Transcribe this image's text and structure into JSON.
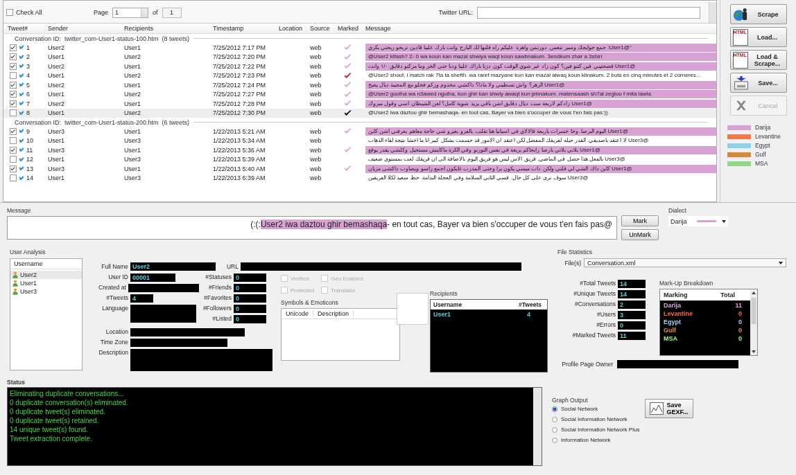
{
  "toolbar": {
    "check_all": {
      "label": "Check All",
      "checked": false
    },
    "page_label": "Page",
    "page_value": "1",
    "of_label": "of",
    "page_count": "1",
    "url_label": "Twitter URL:"
  },
  "table": {
    "columns": [
      "Tweet#",
      "Sender",
      "Recipients",
      "Timestamp",
      "Location",
      "Source",
      "Marked",
      "Message"
    ],
    "groups": [
      {
        "title": "Conversation ID:  twitter_com-User1-status-100.htm  (8 tweets)",
        "rows": [
          {
            "checked": true,
            "num": "1",
            "sender": "User2",
            "recipient": "User1",
            "time": "7/25/2012 7:17 PM",
            "source": "web",
            "kind": "dialect",
            "highlighted": true,
            "selected": false,
            "rtl": true,
            "message": "\"@User1: جمع حوايجك وسير تنعس. دورتمن واهرة عليكم راه قلتها لك البارح وانت بارك علينا قادين تربحو ربحتي بكري"
          },
          {
            "checked": true,
            "num": "2",
            "sender": "User1",
            "recipient": "User2",
            "time": "7/25/2012 7:20 PM",
            "source": "web",
            "kind": "dialect",
            "highlighted": true,
            "selected": false,
            "rtl": false,
            "message": "@User2 kifash?  2- 0 wa koun kan mazal shwiya waqt koun sawbnakum. 3endkum zhar a 3shiri"
          },
          {
            "checked": true,
            "num": "3",
            "sender": "User2",
            "recipient": "User1",
            "time": "7/25/2012 7:22 PM",
            "source": "web",
            "kind": "dialect",
            "highlighted": true,
            "selected": false,
            "rtl": true,
            "message": "@User1 فضحتيني فين كنتو فين؟ كون زاد غير شوي الوقت كون دزنا باراك علينا ودبا حتى الخر وما مركتو دقايق ١/٠ وانت"
          },
          {
            "checked": false,
            "num": "4",
            "sender": "User1",
            "recipient": "User2",
            "time": "7/25/2012 7:23 PM",
            "source": "web",
            "kind": "new",
            "highlighted": false,
            "selected": false,
            "rtl": false,
            "message": "@User2 shouf, l match rak 7ta ta shefth.  wa raref mazyane kun kan mazal alwaq koun klinakum. 2 buts en cinq minutes et 2 corneres..."
          },
          {
            "checked": true,
            "num": "5",
            "sender": "User2",
            "recipient": "User1",
            "time": "7/25/2012 7:24 PM",
            "source": "web",
            "kind": "dialect",
            "highlighted": true,
            "selected": false,
            "rtl": true,
            "message": "@User1 الزهر؟ واش تسطيني ولا ماذا؟ داكشي مخدوم وزكم فخلو مع المجيبة ديال يصح"
          },
          {
            "checked": true,
            "num": "6",
            "sender": "User1",
            "recipient": "User2",
            "time": "7/25/2012 7:27 PM",
            "source": "web",
            "kind": "dialect",
            "highlighted": true,
            "selected": false,
            "rtl": false,
            "message": "@User2 guolha wa n3awed ngulha, kun ghir kan shwiy awaqt kun jebnakum. matensaash sh7al zeglou f mita lawla"
          },
          {
            "checked": true,
            "num": "7",
            "sender": "User2",
            "recipient": "User1",
            "time": "7/25/2012 7:28 PM",
            "source": "web",
            "kind": "dialect",
            "highlighted": true,
            "selected": false,
            "rtl": true,
            "message": "@User1 زادكم لاربعة ست ديال دقايق اشن باقي يزيد شوية كامل؟ لعن الشيطان اسي وقول مبروك"
          },
          {
            "checked": false,
            "num": "8",
            "sender": "User1",
            "recipient": "User2",
            "time": "7/25/2012 7:30 PM",
            "source": "web",
            "kind": "current",
            "highlighted": false,
            "selected": true,
            "rtl": false,
            "message": "@User2 iwa daztou ghir bemashaqa- en tout cas, Bayer va bien s'occuper de vous t'en fais pas:))"
          }
        ]
      },
      {
        "title": "Conversation ID:  twitter_com-User1-status-200.htm  (6 tweets)",
        "rows": [
          {
            "checked": true,
            "num": "9",
            "sender": "User3",
            "recipient": "User1",
            "time": "1/22/2013 5:21 AM",
            "source": "web",
            "kind": "dialect",
            "highlighted": true,
            "selected": false,
            "rtl": true,
            "message": "@User1 اليوم البرصا. وخا خسرات باربعة فالالاي في اسبانيا هنا تقلب. بالفرو بغيرو شي حاجة معاهم يعرفني اشن كاين"
          },
          {
            "checked": false,
            "num": "10",
            "sender": "User1",
            "recipient": "User3",
            "time": "1/22/2013 5:34 AM",
            "source": "web",
            "kind": "none",
            "highlighted": false,
            "selected": false,
            "rtl": true,
            "message": "@User3 لا اعتقد باصديقي. القدر حيله لفريقك المفضل لكن اعتقد ان الامور قد حسمت بشكل كبير انا ما اخشا نتيجة لقاء الذهاب"
          },
          {
            "checked": true,
            "num": "11",
            "sender": "User3",
            "recipient": "User1",
            "time": "1/22/2013 5:36 AM",
            "source": "web",
            "kind": "dialect",
            "highlighted": true,
            "selected": false,
            "rtl": true,
            "message": "@User1 بلاتي بلاتي بارصا رابحاكم بربعة في نفس التورنو وفي الكرة ماكاينش مستحيل وكلشي يقدر يوقع"
          },
          {
            "checked": false,
            "num": "12",
            "sender": "User1",
            "recipient": "User3",
            "time": "1/22/2013 5:39 AM",
            "source": "web",
            "kind": "none",
            "highlighted": false,
            "selected": false,
            "rtl": true,
            "message": "@User3 بالفعل هذا حصل في الماضي. فريق الاس ليس هو فريق اليوم بالاضافة الى ان فريقك لعب بمستوى ضعيف"
          },
          {
            "checked": true,
            "num": "13",
            "sender": "User3",
            "recipient": "User1",
            "time": "1/22/2013 5:40 AM",
            "source": "web",
            "kind": "dialect",
            "highlighted": true,
            "selected": false,
            "rtl": true,
            "message": "@User1 كاين داك الشي لي قلتي ولكن داب ميسي يكون برا وحتى المدرب غايكون اجمع راسو ويصاوب داكشي مزيان"
          },
          {
            "checked": false,
            "num": "14",
            "sender": "User1",
            "recipient": "User3",
            "time": "1/22/2013 6:39 AM",
            "source": "web",
            "kind": "none",
            "highlighted": false,
            "selected": false,
            "rtl": true,
            "message": "@User3 سوف نرى على كل حال. فسي الثاني السلامة وفي العجلة الندامة. حظ سعيد لكلا الفريقين"
          }
        ]
      }
    ]
  },
  "actions": [
    {
      "kind": "scrape",
      "label": "Scrape",
      "disabled": false
    },
    {
      "kind": "load",
      "label": "Load...",
      "badge": "HTML",
      "disabled": false
    },
    {
      "kind": "load",
      "label": "Load & Scrape...",
      "badge": "HTML",
      "disabled": false
    },
    {
      "kind": "save",
      "label": "Save...",
      "disabled": false
    },
    {
      "kind": "cancel",
      "label": "Cancel",
      "disabled": true
    }
  ],
  "legend": [
    {
      "label": "Darija",
      "color": "#d8a0d4"
    },
    {
      "label": "Levantine",
      "color": "#f47a4c"
    },
    {
      "label": "Egypt",
      "color": "#8fd0ec"
    },
    {
      "label": "Gulf",
      "color": "#d4883c"
    },
    {
      "label": "MSA",
      "color": "#90d888"
    }
  ],
  "message": {
    "label": "Message",
    "parts": [
      {
        "text": "(:(:",
        "highlighted": false
      },
      {
        "text": "User2 iwa daztou ghir bemashaqa",
        "highlighted": true
      },
      {
        "text": "- en tout cas, Bayer va bien s'occuper de vous t'en fais pas@",
        "highlighted": false
      }
    ],
    "mark_button": "Mark",
    "unmark_button": "UnMark",
    "dialect": {
      "label": "Dialect",
      "value": "Darija",
      "color": "#d8a0d4"
    }
  },
  "user_analysis": {
    "title": "User Analysis",
    "users_header": "Username",
    "users": [
      {
        "name": "User2",
        "selected": true
      },
      {
        "name": "User1",
        "selected": false
      },
      {
        "name": "User3",
        "selected": false
      }
    ],
    "full_name": {
      "label": "Full Name",
      "value": "User2"
    },
    "url": {
      "label": "URL"
    },
    "left_fields": [
      {
        "label": "User ID",
        "value": "00001"
      },
      {
        "label": "Created at"
      },
      {
        "label": "#Tweets",
        "value": "4"
      },
      {
        "label": "Language"
      }
    ],
    "counts": [
      {
        "label": "#Statuses",
        "value": "0"
      },
      {
        "label": "#Friends",
        "value": "0"
      },
      {
        "label": "#Favorites",
        "value": "0"
      },
      {
        "label": "#Followers",
        "value": "0"
      },
      {
        "label": "#Listed",
        "value": "0"
      }
    ],
    "flags": [
      {
        "label": "Verified",
        "checked": false,
        "disabled": true
      },
      {
        "label": "Geo Enabled",
        "checked": false,
        "disabled": true
      },
      {
        "label": "Protected",
        "checked": false,
        "disabled": true
      },
      {
        "label": "Translator",
        "checked": false,
        "disabled": true
      }
    ],
    "symbols": {
      "title": "Symbols & Emoticons",
      "columns": [
        "Unicode",
        "Description"
      ]
    },
    "recipients": {
      "title": "Recipients",
      "columns": [
        "Username",
        "#Tweets"
      ],
      "rows": [
        {
          "name": "User1",
          "count": "4"
        }
      ]
    },
    "bottom_fields": [
      {
        "label": "Location"
      },
      {
        "label": "Time Zone"
      },
      {
        "label": "Description"
      }
    ]
  },
  "file_statistics": {
    "title": "File Statistics",
    "file_label": "File(s)",
    "file_value": "Conversation.xml",
    "stats": [
      {
        "label": "#Total Tweets",
        "value": "14"
      },
      {
        "label": "#Unique Tweets",
        "value": "14"
      },
      {
        "label": "#Conversations",
        "value": "2"
      },
      {
        "label": "#Users",
        "value": "3"
      },
      {
        "label": "#Errors",
        "value": "0"
      },
      {
        "label": "#Marked Tweets",
        "value": "11"
      }
    ],
    "owner_label": "Profile Page Owner",
    "breakdown_title": "Mark-Up Breakdown",
    "breakdown_columns": [
      "Marking",
      "Total"
    ],
    "breakdown": [
      {
        "label": "Darija",
        "total": "11",
        "color": "#e0a4e0"
      },
      {
        "label": "Levantine",
        "total": "0",
        "color": "#ff6a48"
      },
      {
        "label": "Egypt",
        "total": "0",
        "color": "#a0d4f4"
      },
      {
        "label": "Gulf",
        "total": "0",
        "color": "#e89040"
      },
      {
        "label": "MSA",
        "total": "0",
        "color": "#a8f080"
      }
    ]
  },
  "status": {
    "label": "Status",
    "lines": [
      "Eliminating duplicate conversations...",
      "0 duplicate conversation(s) eliminated.",
      "0 duplicate tweet(s) eliminated.",
      "0 duplicate tweet(s) retained.",
      "14 unique tweet(s) found.",
      "Tweet extraction complete."
    ]
  },
  "graph_output": {
    "label": "Graph Output",
    "options": [
      {
        "label": "Social Network",
        "selected": true
      },
      {
        "label": "Social Information Network",
        "selected": false
      },
      {
        "label": "Social Information Network Plus",
        "selected": false
      },
      {
        "label": "Information Network",
        "selected": false
      }
    ],
    "save_button": "Save GEXF..."
  }
}
